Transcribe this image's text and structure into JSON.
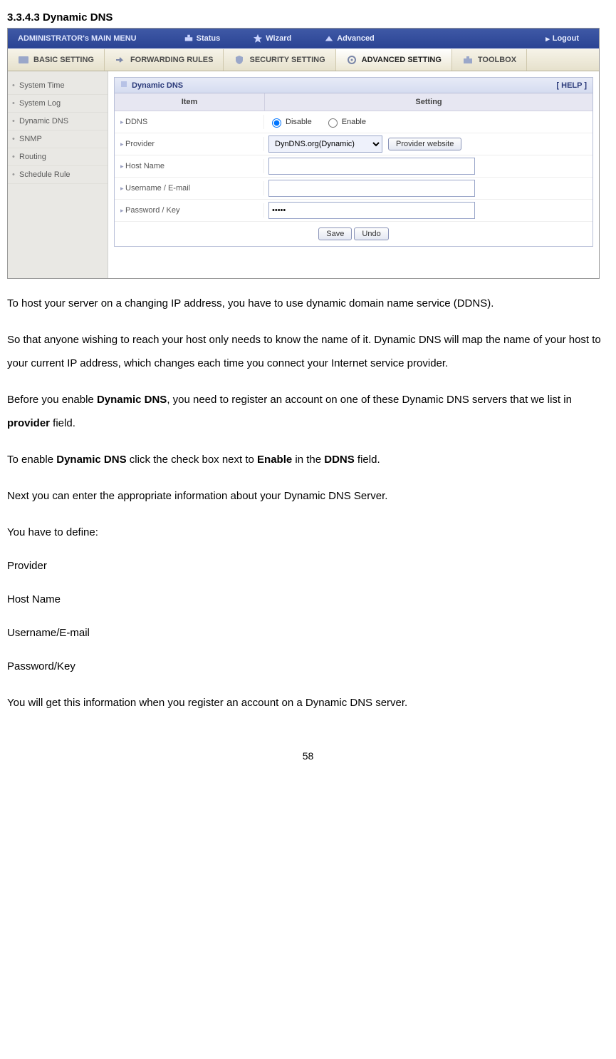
{
  "heading": "3.3.4.3 Dynamic DNS",
  "topbar": {
    "title": "ADMINISTRATOR's MAIN MENU",
    "nav": {
      "status": "Status",
      "wizard": "Wizard",
      "advanced": "Advanced",
      "logout": "Logout"
    }
  },
  "tabs": {
    "basic": "BASIC SETTING",
    "forwarding": "FORWARDING RULES",
    "security": "SECURITY SETTING",
    "advanced": "ADVANCED SETTING",
    "toolbox": "TOOLBOX"
  },
  "sidebar": {
    "items": [
      "System Time",
      "System Log",
      "Dynamic DNS",
      "SNMP",
      "Routing",
      "Schedule Rule"
    ]
  },
  "panel": {
    "title": "Dynamic DNS",
    "help": "[ HELP ]",
    "headers": {
      "item": "Item",
      "setting": "Setting"
    },
    "rows": {
      "ddns": {
        "label": "DDNS",
        "opt_disable": "Disable",
        "opt_enable": "Enable",
        "selected": "disable"
      },
      "provider": {
        "label": "Provider",
        "value": "DynDNS.org(Dynamic)",
        "button": "Provider website"
      },
      "hostname": {
        "label": "Host Name",
        "value": ""
      },
      "username": {
        "label": "Username / E-mail",
        "value": ""
      },
      "password": {
        "label": "Password / Key",
        "value": "•••••"
      }
    },
    "buttons": {
      "save": "Save",
      "undo": "Undo"
    }
  },
  "doc": {
    "p1": "To host your server on a changing IP address, you have to use dynamic domain name service (DDNS).",
    "p2": "So that anyone wishing to reach your host only needs to know the name of it. Dynamic DNS will map the name of your host to your current IP address, which changes each time you connect your Internet service provider.",
    "p3a": "Before you enable ",
    "p3b": "Dynamic DNS",
    "p3c": ", you need to register an account on one of these Dynamic DNS servers that we list in ",
    "p3d": "provider",
    "p3e": " field.",
    "p4a": "To enable ",
    "p4b": "Dynamic DNS",
    "p4c": " click the check box next to ",
    "p4d": "Enable",
    "p4e": " in the ",
    "p4f": "DDNS",
    "p4g": " field.",
    "p5": "Next you can enter the appropriate information about your Dynamic DNS Server.",
    "p6": "You have to define:",
    "p7": "Provider",
    "p8": "Host Name",
    "p9": "Username/E-mail",
    "p10": "Password/Key",
    "p11": "You will get this information when you register an account on a Dynamic DNS server."
  },
  "page_number": "58"
}
